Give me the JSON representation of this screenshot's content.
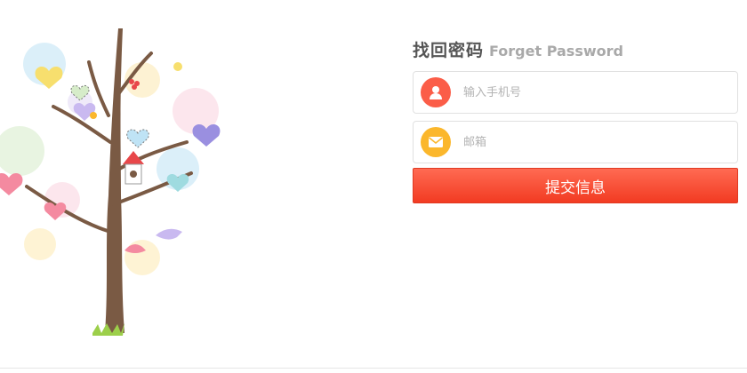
{
  "header": {
    "title_cn": "找回密码",
    "title_en": "Forget Password"
  },
  "form": {
    "phone_placeholder": "输入手机号",
    "email_placeholder": "邮箱",
    "submit_label": "提交信息",
    "phone_icon": "user-icon",
    "email_icon": "mail-icon"
  },
  "colors": {
    "accent_red": "#f23b22",
    "user_icon_bg": "#fb5d48",
    "mail_icon_bg": "#fbb72c",
    "title_text": "#555555",
    "subtitle_text": "#a9a9a9"
  }
}
